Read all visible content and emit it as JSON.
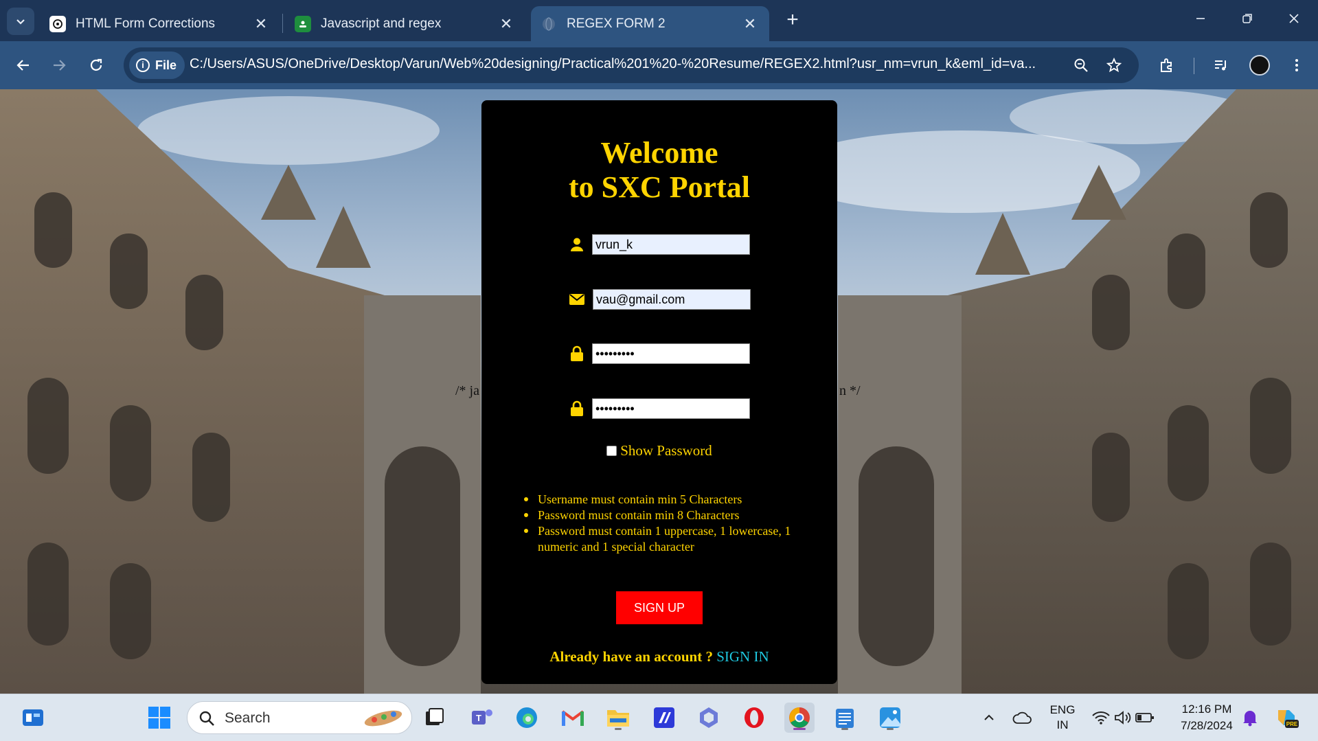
{
  "browser": {
    "tabs": [
      {
        "title": "HTML Form Corrections",
        "close": "✕",
        "active": false
      },
      {
        "title": "Javascript and regex",
        "close": "✕",
        "active": false
      },
      {
        "title": "REGEX FORM 2",
        "close": "✕",
        "active": true
      }
    ],
    "new_tab": "+",
    "window_controls": {
      "minimize": "—",
      "restore": "❐",
      "close": "✕"
    },
    "address": {
      "chip_label": "File",
      "url": "C:/Users/ASUS/OneDrive/Desktop/Varun/Web%20designing/Practical%201%20-%20Resume/REGEX2.html?usr_nm=vrun_k&eml_id=va..."
    }
  },
  "page": {
    "stray_left": "/* ja",
    "stray_right": "n */",
    "form": {
      "heading_line1": "Welcome",
      "heading_line2": "to SXC Portal",
      "username": "vrun_k",
      "email": "vau@gmail.com",
      "password": "•••••••••",
      "confirm_password": "•••••••••",
      "show_password_label": "Show Password",
      "rules": [
        "Username must contain min 5 Characters",
        "Password must contain min 8 Characters",
        "Password must contain 1 uppercase, 1 lowercase, 1 numeric and 1 special character"
      ],
      "signup_label": "SIGN UP",
      "already_text": "Already have an account ?",
      "signin_label": "SIGN IN"
    },
    "colors": {
      "accent_yellow": "#ffd400",
      "signup_red": "#ff0000",
      "link_cyan": "#1ec8e0"
    }
  },
  "taskbar": {
    "search_label": "Search",
    "lang_line1": "ENG",
    "lang_line2": "IN",
    "time": "12:16 PM",
    "date": "7/28/2024"
  }
}
